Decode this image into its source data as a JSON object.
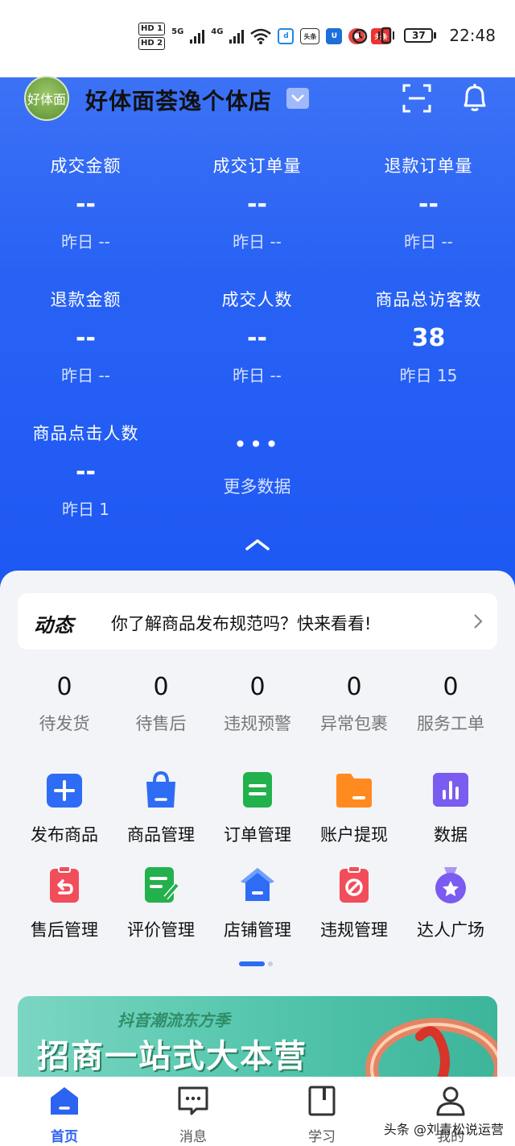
{
  "status_bar": {
    "sim1": "HD 1",
    "sim2": "HD 2",
    "net1": "5G",
    "net2": "4G",
    "app_badges": [
      "头条",
      "头条"
    ],
    "battery": "37",
    "time": "22:48"
  },
  "header": {
    "avatar_text": "好体面",
    "shop_name": "好体面荟逸个体店"
  },
  "stats": [
    {
      "label": "成交金额",
      "value": "--",
      "yesterday": "昨日 --"
    },
    {
      "label": "成交订单量",
      "value": "--",
      "yesterday": "昨日 --"
    },
    {
      "label": "退款订单量",
      "value": "--",
      "yesterday": "昨日 --"
    },
    {
      "label": "退款金额",
      "value": "--",
      "yesterday": "昨日 --"
    },
    {
      "label": "成交人数",
      "value": "--",
      "yesterday": "昨日 --"
    },
    {
      "label": "商品总访客数",
      "value": "38",
      "yesterday": "昨日 15"
    },
    {
      "label": "商品点击人数",
      "value": "--",
      "yesterday": "昨日 1"
    }
  ],
  "more": {
    "dots": "•••",
    "label": "更多数据"
  },
  "news": {
    "tag": "动态",
    "text": "你了解商品发布规范吗？快来看看!"
  },
  "counts": [
    {
      "num": "0",
      "label": "待发货"
    },
    {
      "num": "0",
      "label": "待售后"
    },
    {
      "num": "0",
      "label": "违规预警"
    },
    {
      "num": "0",
      "label": "异常包裹"
    },
    {
      "num": "0",
      "label": "服务工单"
    }
  ],
  "tools": [
    {
      "label": "发布商品",
      "icon": "plus-square-icon",
      "color": "#2f6cf5"
    },
    {
      "label": "商品管理",
      "icon": "shopping-bag-icon",
      "color": "#2f6cf5"
    },
    {
      "label": "订单管理",
      "icon": "order-list-icon",
      "color": "#22b14c"
    },
    {
      "label": "账户提现",
      "icon": "wallet-icon",
      "color": "#ff8a1f"
    },
    {
      "label": "数据",
      "icon": "bar-chart-icon",
      "color": "#7a5cf0"
    },
    {
      "label": "售后管理",
      "icon": "return-icon",
      "color": "#f24d5b"
    },
    {
      "label": "评价管理",
      "icon": "review-icon",
      "color": "#22b14c"
    },
    {
      "label": "店铺管理",
      "icon": "store-home-icon",
      "color": "#2f6cf5"
    },
    {
      "label": "违规管理",
      "icon": "ban-icon",
      "color": "#f24d5b"
    },
    {
      "label": "达人广场",
      "icon": "medal-star-icon",
      "color": "#7a5cf0"
    }
  ],
  "banner": {
    "sub": "抖音潮流东方季",
    "main": "招商一站式大本营"
  },
  "nav": [
    {
      "label": "首页",
      "icon": "home-icon",
      "active": true
    },
    {
      "label": "消息",
      "icon": "message-icon",
      "active": false
    },
    {
      "label": "学习",
      "icon": "book-icon",
      "active": false
    },
    {
      "label": "我的",
      "icon": "user-icon",
      "active": false
    }
  ],
  "watermark": "头条 @刘青松说运营"
}
